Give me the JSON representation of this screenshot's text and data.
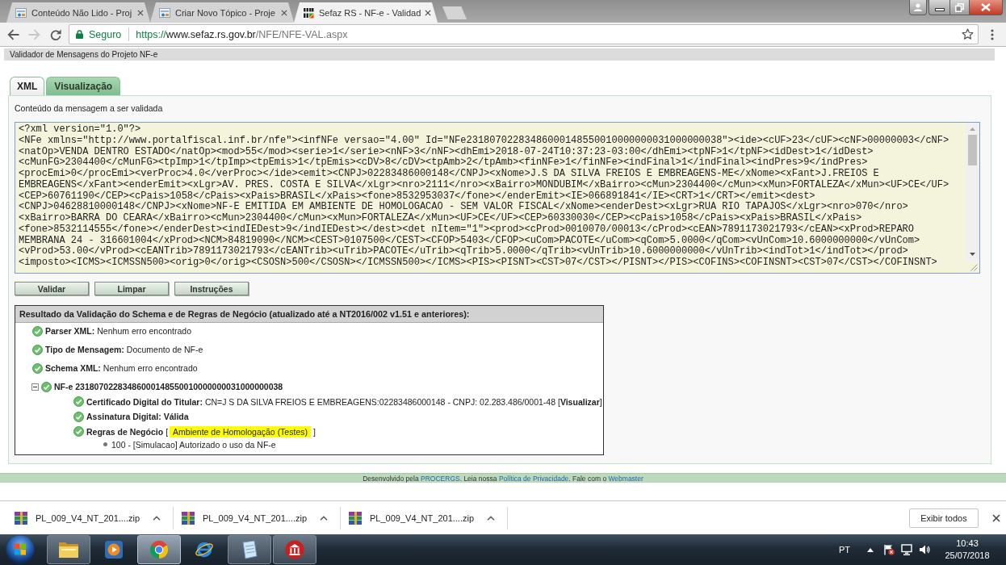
{
  "browser": {
    "tabs": [
      {
        "title": "Conteúdo Não Lido - Proj",
        "kind": "forum",
        "selected": false
      },
      {
        "title": "Criar Novo Tópico - Proje",
        "kind": "forum",
        "selected": false
      },
      {
        "title": "Sefaz RS - NF-e - Validad",
        "kind": "sefaz",
        "selected": true
      }
    ],
    "forward_disabled": true,
    "address": {
      "security": "Seguro",
      "scheme": "https://",
      "host": "www.sefaz.rs.gov.br",
      "path": "/NFE/NFE-VAL.aspx"
    }
  },
  "page": {
    "header": "Validador de Mensagens do Projeto NF-e",
    "tabs": [
      {
        "label": "XML",
        "selected": true
      },
      {
        "label": "Visualização",
        "selected": false
      }
    ],
    "message_label": "Conteúdo da mensagem a ser validada",
    "xml_lines": [
      "<?xml version=\"1.0\"?>",
      "<NFe xmlns=\"http://www.portalfiscal.inf.br/nfe\"><infNFe versao=\"4.00\" Id=\"NFe23180702283486000148550010000000031000000038\"><ide><cUF>23</cUF><cNF>00000003</cNF>",
      "<natOp>VENDA DENTRO ESTADO</natOp><mod>55</mod><serie>1</serie><nNF>3</nNF><dhEmi>2018-07-24T10:37:23-03:00</dhEmi><tpNF>1</tpNF><idDest>1</idDest>",
      "<cMunFG>2304400</cMunFG><tpImp>1</tpImp><tpEmis>1</tpEmis><cDV>8</cDV><tpAmb>2</tpAmb><finNFe>1</finNFe><indFinal>1</indFinal><indPres>9</indPres>",
      "<procEmi>0</procEmi><verProc>4.0</verProc></ide><emit><CNPJ>02283486000148</CNPJ><xNome>J.S DA SILVA FREIOS E EMBREAGENS-ME</xNome><xFant>J.FREIOS E",
      "EMBREAGENS</xFant><enderEmit><xLgr>AV. PRES. COSTA E SILVA</xLgr><nro>2111</nro><xBairro>MONDUBIM</xBairro><cMun>2304400</cMun><xMun>FORTALEZA</xMun><UF>CE</UF>",
      "<CEP>60761190</CEP><cPais>1058</cPais><xPais>BRASIL</xPais><fone>8532953037</fone></enderEmit><IE>066891841</IE><CRT>1</CRT></emit><dest>",
      "<CNPJ>04628810000148</CNPJ><xNome>NF-E EMITIDA EM AMBIENTE DE HOMOLOGACAO - SEM VALOR FISCAL</xNome><enderDest><xLgr>RUA RIO TAPAJOS</xLgr><nro>070</nro>",
      "<xBairro>BARRA DO CEARA</xBairro><cMun>2304400</cMun><xMun>FORTALEZA</xMun><UF>CE</UF><CEP>60330030</CEP><cPais>1058</cPais><xPais>BRASIL</xPais>",
      "<fone>8532114555</fone></enderDest><indIEDest>9</indIEDest></dest><det nItem=\"1\"><prod><cProd>0010070/00013</cProd><cEAN>7891173021793</cEAN><xProd>REPARO",
      "MEMBRANA 24 - 316601004</xProd><NCM>84819090</NCM><CEST>0107500</CEST><CFOP>5403</CFOP><uCom>PACOTE</uCom><qCom>5.0000</qCom><vUnCom>10.6000000000</vUnCom>",
      "<vProd>53.00</vProd><cEANTrib>7891173021793</cEANTrib><uTrib>PACOTE</uTrib><qTrib>5.0000</qTrib><vUnTrib>10.6000000000</vUnTrib><indTot>1</indTot></prod>",
      "<imposto><ICMS><ICMSSN500><orig>0</orig><CSOSN>500</CSOSN></ICMSSN500></ICMS><PIS><PISNT><CST>07</CST></PISNT></PIS><COFINS><COFINSNT><CST>07</CST></COFINSNT>"
    ],
    "buttons": [
      "Validar",
      "Limpar",
      "Instruções"
    ],
    "result": {
      "title": "Resultado da Validação do Schema e de Regras de Negócio (atualizado até a NT2016/002 v1.51 e anteriores):",
      "items": [
        {
          "label": "Parser XML:",
          "value": "Nenhum erro encontrado",
          "kind": "check"
        },
        {
          "label": "Tipo de Mensagem:",
          "value": "Documento de NF-e",
          "kind": "check"
        },
        {
          "label": "Schema XML:",
          "value": "Nenhum erro encontrado",
          "kind": "check"
        },
        {
          "label": "NF-e 23180702283486000148550010000000031000000038",
          "kind": "check",
          "expanded": true,
          "children": [
            {
              "label": "Certificado Digital do Titular:",
              "value": "CN=J S DA SILVA FREIOS E EMBREAGENS:02283486000148 - CNPJ: 02.283.486/0001-48 [**Visualizar**]",
              "kind": "check"
            },
            {
              "label": "Assinatura Digital: Válida",
              "kind": "check"
            },
            {
              "label": "Regras de Negócio",
              "kind": "check",
              "tag": {
                "open": "[",
                "text": "Ambiente de Homologação (Testes)",
                "close": "]"
              },
              "children": [
                {
                  "value": "100 - [Simulacao] Autorizado o uso da NF-e",
                  "kind": "bullet"
                }
              ]
            }
          ]
        }
      ]
    },
    "footer": [
      {
        "text": "Desenvolvido pela ",
        "kind": "plain"
      },
      {
        "text": "PROCERGS",
        "kind": "link"
      },
      {
        "text": ". Leia nossa ",
        "kind": "plain"
      },
      {
        "text": "Política de Privacidade",
        "kind": "link"
      },
      {
        "text": ". Fale com o ",
        "kind": "plain"
      },
      {
        "text": "Webmaster",
        "kind": "link"
      }
    ]
  },
  "downloads": {
    "files": [
      {
        "name": "PL_009_V4_NT_201....zip"
      },
      {
        "name": "PL_009_V4_NT_201....zip"
      },
      {
        "name": "PL_009_V4_NT_201....zip"
      }
    ],
    "show_all": "Exibir todos"
  },
  "taskbar": {
    "apps": [
      {
        "kind": "folder",
        "running": true,
        "selected": false
      },
      {
        "kind": "player",
        "running": false,
        "selected": false
      },
      {
        "kind": "circle",
        "running": true,
        "selected": true
      },
      {
        "kind": "orbit",
        "running": false,
        "selected": false
      },
      {
        "kind": "notepad",
        "running": true,
        "selected": false
      },
      {
        "kind": "building",
        "running": true,
        "selected": false
      }
    ],
    "language": "PT",
    "time": "10:43",
    "date": "25/07/2018"
  }
}
